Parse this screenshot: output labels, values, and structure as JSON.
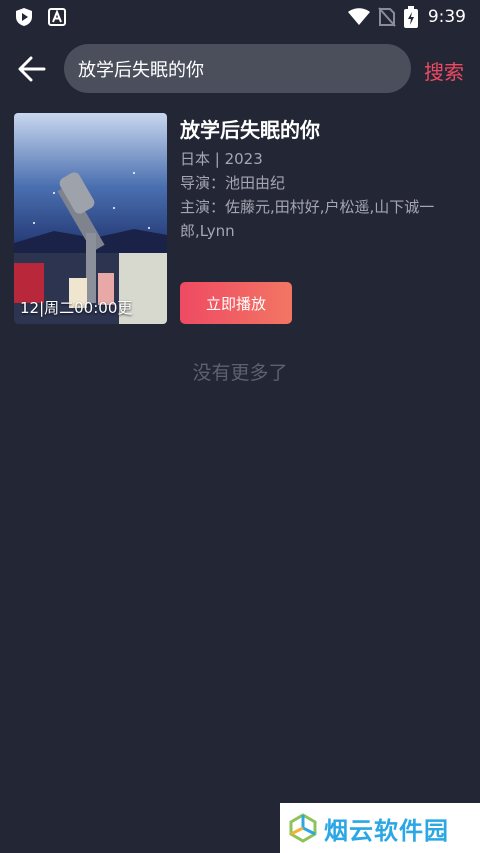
{
  "status_bar": {
    "time": "9:39",
    "icons": [
      "play-shield-icon",
      "a-box-icon",
      "wifi-icon",
      "no-sim-icon",
      "battery-charging-icon"
    ]
  },
  "search": {
    "query": "放学后失眠的你",
    "button_label": "搜索",
    "back_icon": "arrow-left-icon"
  },
  "result": {
    "title": "放学后失眠的你",
    "region_year": "日本 | 2023",
    "director": "导演：池田由纪",
    "cast": "主演：佐藤元,田村好,户松遥,山下诚一郎,Lynn",
    "poster_caption": "12|周二00:00更",
    "play_label": "立即播放"
  },
  "footer": {
    "no_more": "没有更多了"
  },
  "watermark": {
    "text": "烟云软件园"
  },
  "colors": {
    "background": "#232634",
    "accent": "#ef4a63",
    "search_box": "#4b4f5c"
  }
}
